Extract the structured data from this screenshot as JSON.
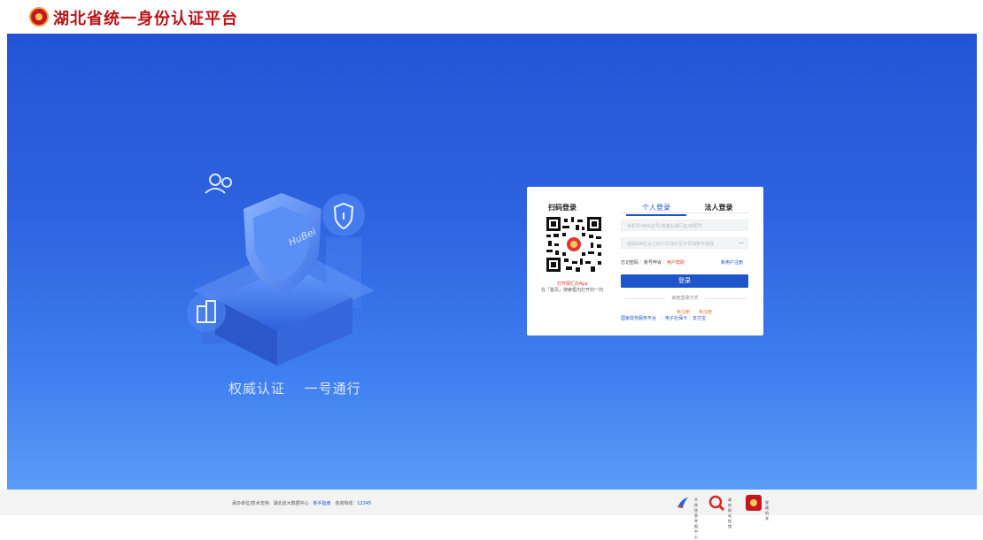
{
  "header": {
    "title": "湖北省统一身份认证平台"
  },
  "hero": {
    "slogan_1": "权威认证",
    "slogan_2": "一号通行",
    "illustration_text": "HuBei"
  },
  "login": {
    "qr_title": "扫码登录",
    "qr_caption_1": "打开鄂汇办App",
    "qr_caption_2": "在「首页」搜索框内打开扫一扫",
    "tabs": [
      {
        "label": "个人登录",
        "active": true
      },
      {
        "label": "法人登录",
        "active": false
      }
    ],
    "username_placeholder": "手机号/身份证号/港澳台通行证/护照号",
    "password_placeholder": "密码由8位以上的小写加大写字母加数字组成",
    "forgot_password": "忘记密码",
    "account_appeal": "账号申诉",
    "user_help": "用户帮助",
    "register": "新用户注册",
    "login_button": "登录",
    "other_methods": "其他登录方式",
    "third_party": [
      {
        "label": "国家政务服务平台"
      },
      {
        "label": "电子社保卡"
      },
      {
        "label": "支付宝"
      }
    ],
    "register_links": [
      {
        "label": "免注册"
      },
      {
        "label": "免注册"
      }
    ]
  },
  "footer": {
    "host_label": "承办单位/技术支持：湖北省大数据中心",
    "guide": "新手指南",
    "hotline_label": "咨询热线：",
    "hotline": "12345",
    "badges": [
      {
        "line1": "不良信息",
        "line2": "举报中心",
        "icon": "report-center-icon"
      },
      {
        "line1": "政府网站",
        "line2": "找错",
        "icon": "gov-site-error-icon"
      },
      {
        "line1": "党政机关",
        "line2": "",
        "icon": "party-gov-icon"
      }
    ]
  },
  "colors": {
    "brand_red": "#b8141a",
    "primary_blue": "#1e55c8",
    "hero_top": "#2454d6",
    "hero_bottom": "#5a9cf6"
  }
}
